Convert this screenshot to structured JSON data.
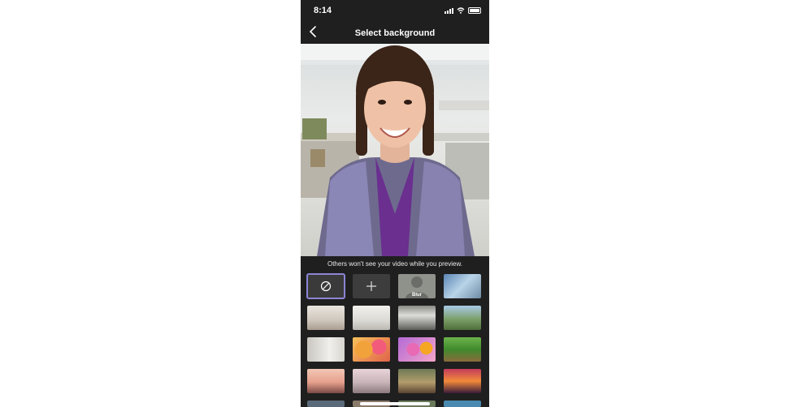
{
  "status_bar": {
    "time": "8:14",
    "icons": [
      "signal-icon",
      "wifi-icon",
      "battery-icon"
    ]
  },
  "header": {
    "title": "Select background",
    "back_icon": "chevron-left-icon"
  },
  "preview": {
    "hint": "Others won't see your video while you preview."
  },
  "backgrounds": {
    "none_icon": "no-background-icon",
    "add_icon": "plus-icon",
    "blur_label": "Blur",
    "selected": "none",
    "images": [
      "office-hallway",
      "modern-room",
      "open-office",
      "mountain-valley",
      "white-loft",
      "colorful-balloons",
      "pink-bubbles",
      "green-minecraft",
      "golden-gate",
      "desert-arch",
      "cozy-living-room",
      "pixel-sunset"
    ]
  },
  "colors": {
    "accent": "#8b85d6",
    "background": "#1f1f1f",
    "text": "#ffffff"
  }
}
